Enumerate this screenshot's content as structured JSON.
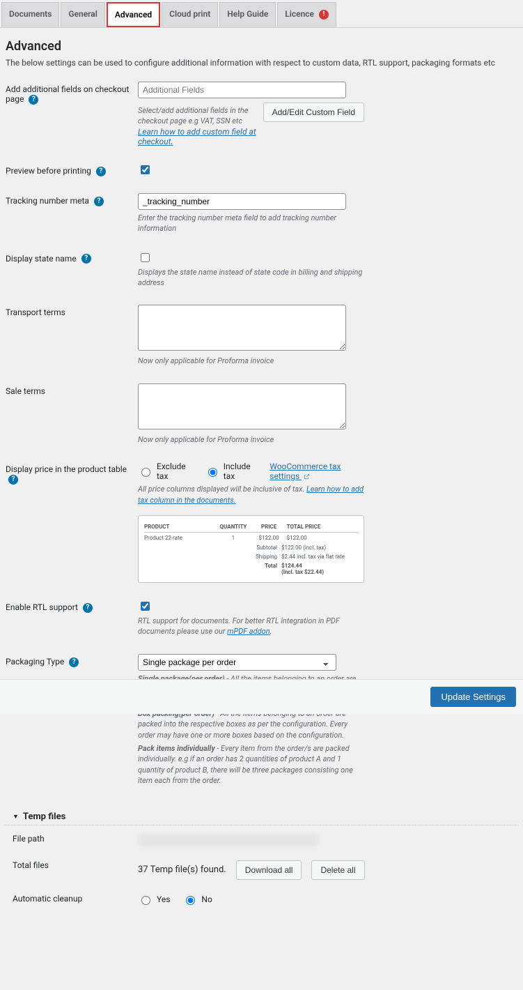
{
  "tabs": {
    "documents": "Documents",
    "general": "General",
    "advanced": "Advanced",
    "cloud_print": "Cloud print",
    "help_guide": "Help Guide",
    "licence": "Licence"
  },
  "heading": "Advanced",
  "desc": "The below settings can be used to configure additional information with respect to custom data, RTL support, packaging formats etc",
  "fields": {
    "add_fields": {
      "label": "Add additional fields on checkout page",
      "placeholder": "Additional Fields",
      "hint1": "Select/add additional fields in the checkout page e.g VAT, SSN etc",
      "link": "Learn how to add custom field at checkout.",
      "btn": "Add/Edit Custom Field"
    },
    "preview": {
      "label": "Preview before printing"
    },
    "tracking": {
      "label": "Tracking number meta",
      "value": "_tracking_number",
      "hint": "Enter the tracking number meta field to add tracking number information"
    },
    "state": {
      "label": "Display state name",
      "hint": "Displays the state name instead of state code in billing and shipping address"
    },
    "transport": {
      "label": "Transport terms",
      "hint": "Now only applicable for Proforma invoice"
    },
    "sale": {
      "label": "Sale terms",
      "hint": "Now only applicable for Proforma invoice"
    },
    "price_display": {
      "label": "Display price in the product table",
      "opt_excl": "Exclude tax",
      "opt_incl": "Include tax",
      "tax_link": "WooCommerce tax settings",
      "hint_a": "All price columns displayed will be inclusive of tax. ",
      "hint_link": "Learn how to add tax column in the documents."
    },
    "rtl": {
      "label": "Enable RTL support",
      "hint_a": "RTL support for documents. For better RTL integration in PDF documents please use our ",
      "hint_link": "mPDF addon",
      "hint_b": "."
    },
    "packaging": {
      "label": "Packaging Type",
      "selected": "Single package per order",
      "d1a": "Single package(per order)",
      "d1b": " - All the items belonging to an order are packed together into a single package. Every order will have a respective package.",
      "d2a": "Box packing(per order)",
      "d2b": " - All the items belonging to an order are packed into the respective boxes as per the configuration. Every order may have one or more boxes based on the configuration.",
      "d3a": "Pack items individually",
      "d3b": " - Every item from the order/s are packed individually. e.g if an order has 2 quantities of product A and 1 quantity of product B, there will be three packages consisting one item each from the order."
    }
  },
  "preview_table": {
    "h_product": "PRODUCT",
    "h_qty": "QUANTITY",
    "h_price": "PRICE",
    "h_total": "TOTAL PRICE",
    "row_name": "Product 22-rate",
    "row_qty": "1",
    "row_price": "$122.00",
    "row_total": "$122.00",
    "sub_l": "Subtotal",
    "sub_v": "$122.00 (incl. tax)",
    "ship_l": "Shipping",
    "ship_v": "$2.44 incl. tax via flat rate",
    "tot_l": "Total",
    "tot_v": "$124.44",
    "tot_v2": "(incl. tax $22.44)"
  },
  "temp": {
    "title": "Temp files",
    "file_path_l": "File path",
    "total_l": "Total files",
    "total_msg": "37 Temp file(s) found.",
    "dl_btn": "Download all",
    "del_btn": "Delete all",
    "auto_l": "Automatic cleanup",
    "yes": "Yes",
    "no": "No"
  },
  "footer": {
    "save": "Update Settings"
  }
}
